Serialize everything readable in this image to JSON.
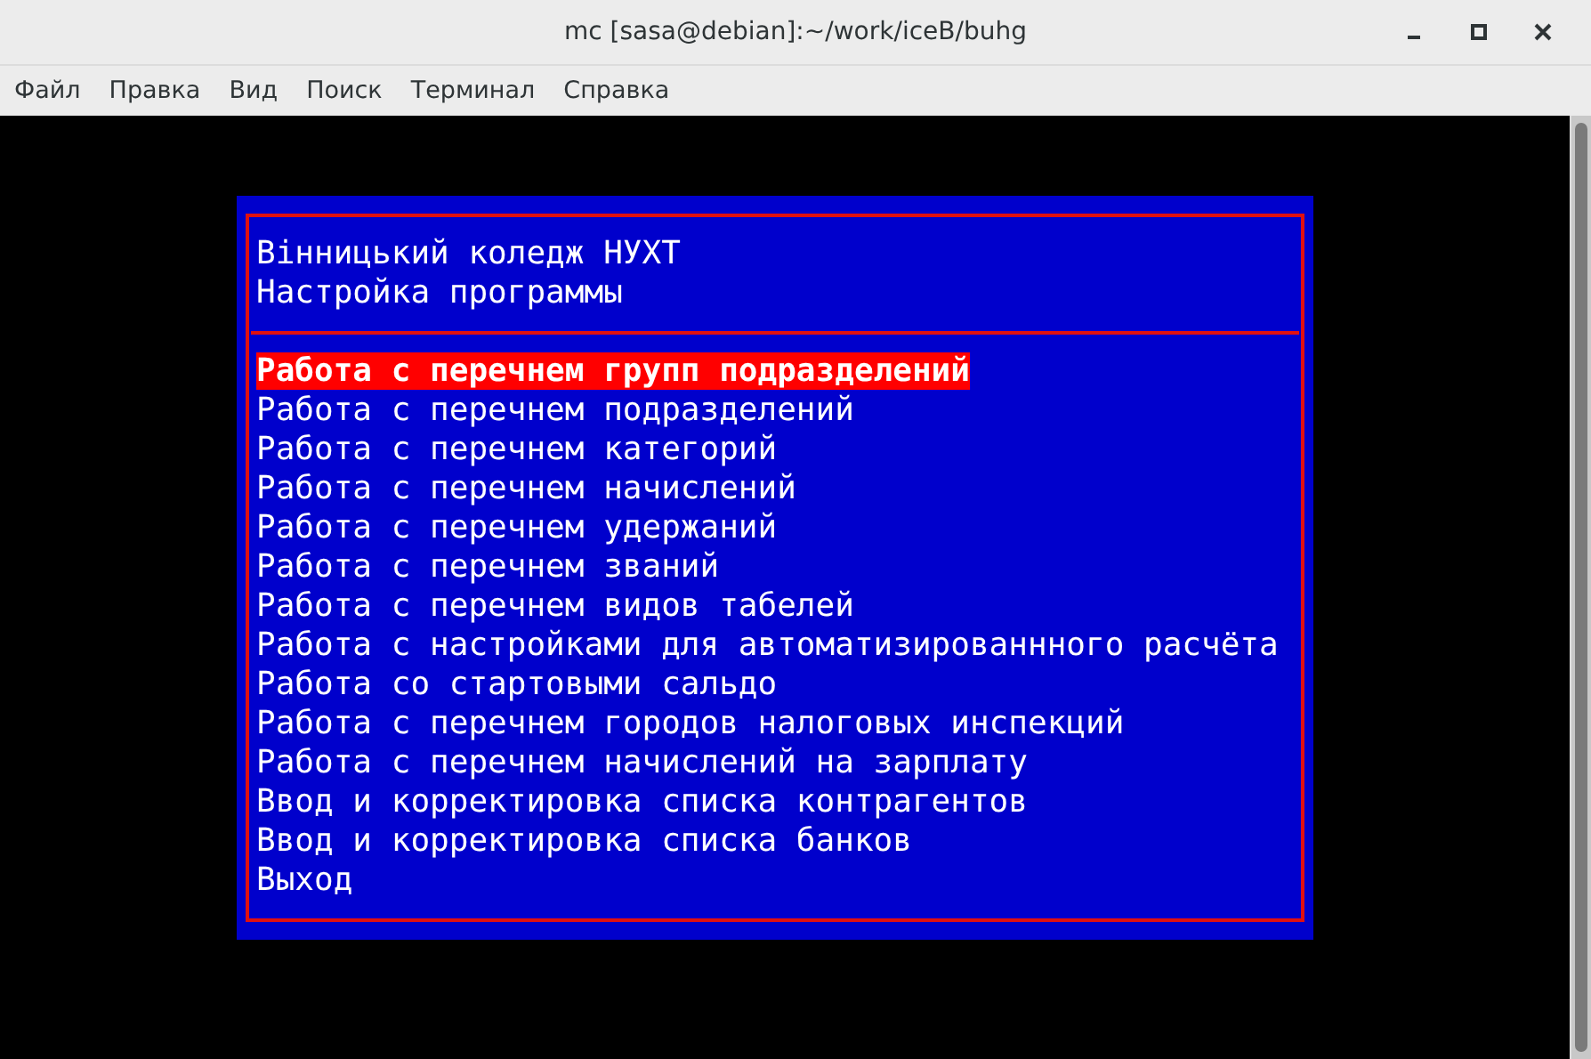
{
  "window": {
    "title": "mc [sasa@debian]:~/work/iceB/buhg"
  },
  "menu": [
    "Файл",
    "Правка",
    "Вид",
    "Поиск",
    "Терминал",
    "Справка"
  ],
  "dialog": {
    "header": [
      "Вінницький коледж НУХТ",
      "Настройка программы"
    ],
    "items": [
      {
        "label": "Работа с перечнем групп подразделений",
        "selected": true
      },
      {
        "label": "Работа с перечнем подразделений",
        "selected": false
      },
      {
        "label": "Работа с перечнем категорий",
        "selected": false
      },
      {
        "label": "Работа с перечнем начислений",
        "selected": false
      },
      {
        "label": "Работа с перечнем удержаний",
        "selected": false
      },
      {
        "label": "Работа с перечнем званий",
        "selected": false
      },
      {
        "label": "Работа с перечнем видов табелей",
        "selected": false
      },
      {
        "label": "Работа с настройками для автоматизированнного расчёта",
        "selected": false
      },
      {
        "label": "Работа со стартовыми сальдо",
        "selected": false
      },
      {
        "label": "Работа с перечнем городов налоговых инспекций",
        "selected": false
      },
      {
        "label": "Работа с перечнем начислений на зарплату",
        "selected": false
      },
      {
        "label": "Ввод и корректировка списка контрагентов",
        "selected": false
      },
      {
        "label": "Ввод и корректировка списка банков",
        "selected": false
      },
      {
        "label": "Выход",
        "selected": false
      }
    ]
  }
}
